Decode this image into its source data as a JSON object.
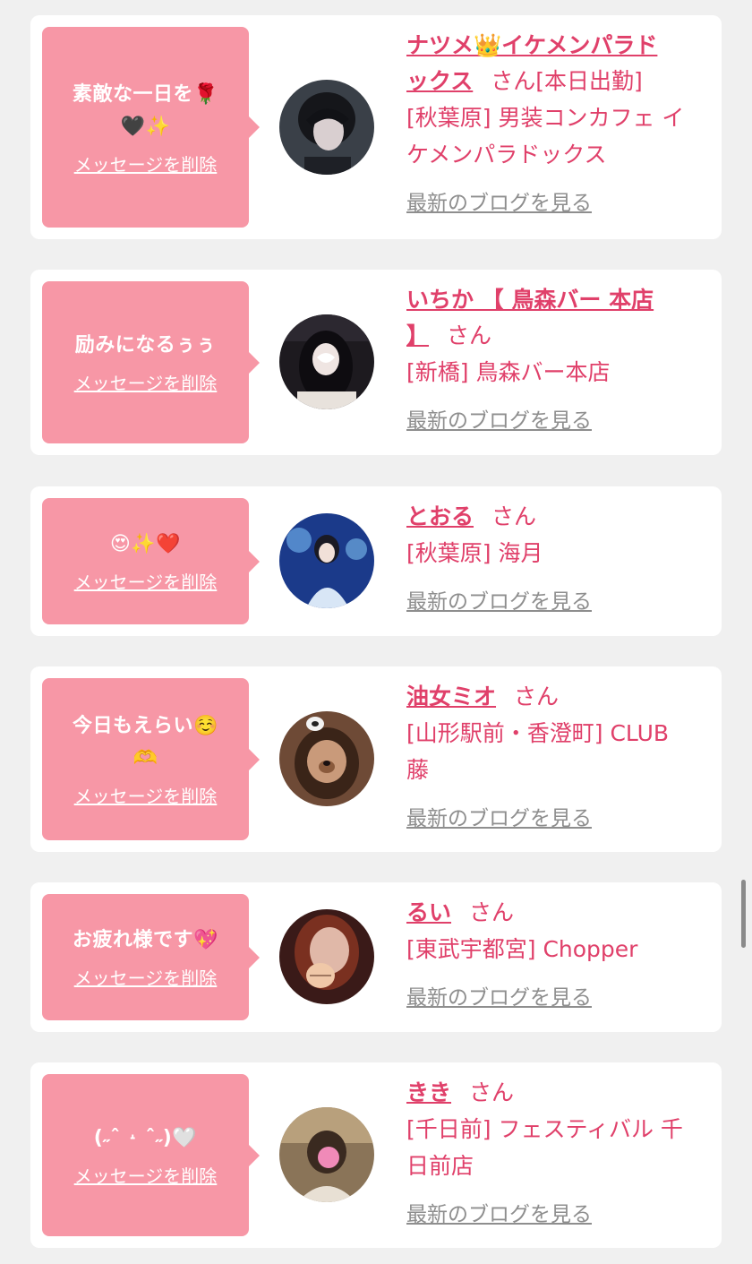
{
  "delete_label": "メッセージを削除",
  "blog_label": "最新のブログを見る",
  "colors": {
    "bubble": "#f797a6",
    "accent": "#e0406a",
    "blog_link": "#8e8e8e",
    "background": "#f0f0f0"
  },
  "cards": [
    {
      "message_line1": "素敵な一日を🌹",
      "message_line2": "🖤✨",
      "name_line1": "ナツメ👑イケメンパラド",
      "name_line2": "ックス",
      "san": "さん",
      "status": "[本日出勤]",
      "shop_line1": "[秋葉原] 男装コンカフェ イ",
      "shop_line2": "ケメンパラドックス"
    },
    {
      "message_line1": "励みになるぅぅ",
      "name_line1": "いちか 【 鳥森バー 本店",
      "name_line2": "】",
      "san": "さん",
      "shop_line1": "[新橋] 鳥森バー本店"
    },
    {
      "message_line1": "😍✨❤️",
      "name_line1": "とおる",
      "san": "さん",
      "shop_line1": "[秋葉原] 海月"
    },
    {
      "message_line1": "今日もえらい☺️",
      "message_line2": "🫶",
      "name_line1": "油女ミオ",
      "san": "さん",
      "shop_line1": "[山形駅前・香澄町] CLUB",
      "shop_line2": "藤"
    },
    {
      "message_line1": "お疲れ様です💖",
      "name_line1": "るい",
      "san": "さん",
      "shop_line1": "[東武宇都宮] Chopper"
    },
    {
      "message_line1": "(˶ˆ ˔ ˆ˶)🤍",
      "name_line1": "きき",
      "san": "さん",
      "shop_line1": "[千日前] フェスティバル 千",
      "shop_line2": "日前店"
    }
  ]
}
